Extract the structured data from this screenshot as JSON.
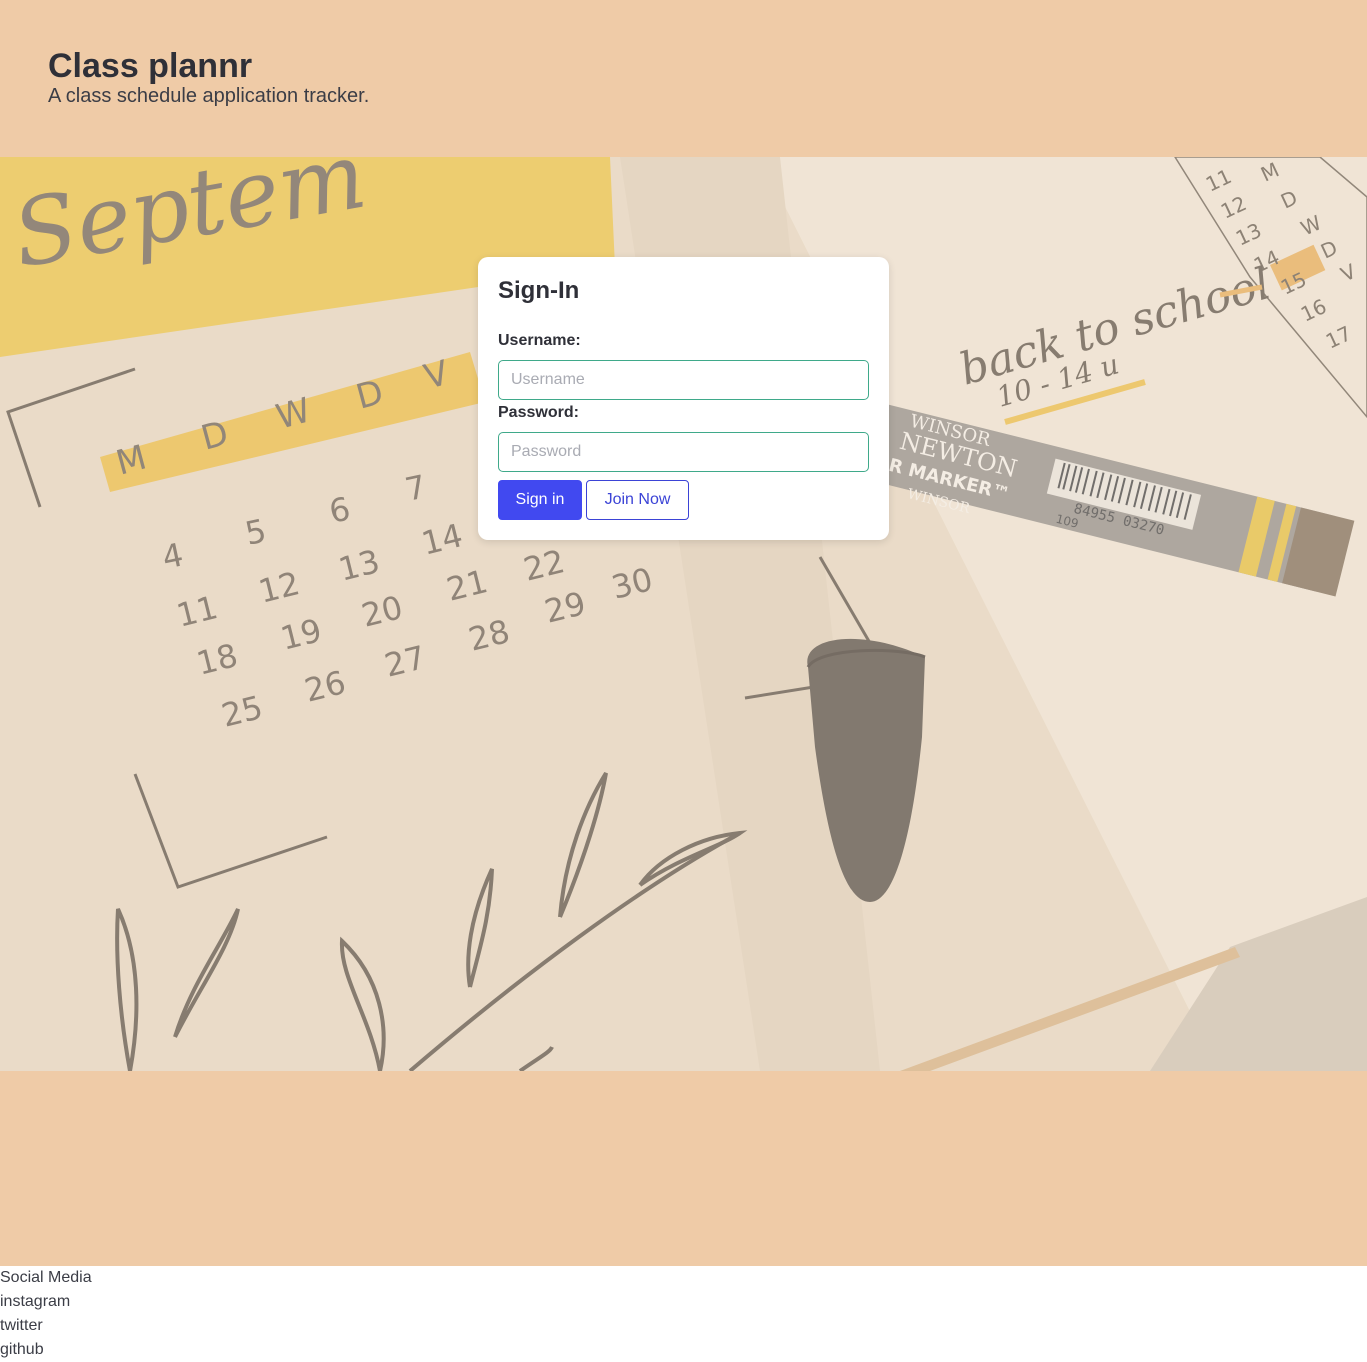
{
  "header": {
    "title": "Class plannr",
    "subtitle": "A class schedule application tracker."
  },
  "signin": {
    "title": "Sign-In",
    "username_label": "Username:",
    "username_placeholder": "Username",
    "username_value": "",
    "password_label": "Password:",
    "password_placeholder": "Password",
    "password_value": "",
    "signin_button": "Sign in",
    "join_button": "Join Now"
  },
  "hero": {
    "month_text": "Septem",
    "weekday_letters": [
      "M",
      "D",
      "W",
      "D",
      "V"
    ],
    "note_line1": "back to school",
    "note_line2": "10 - 14 u",
    "marker_brand1": "WINSOR",
    "marker_brand2": "NEWTON",
    "marker_type": "R MARKER™",
    "marker_brand3": "WINSOR",
    "barcode_number": "84955 03270",
    "marker_code": "109",
    "calendar_numbers": [
      "4",
      "5",
      "6",
      "7",
      "11",
      "12",
      "13",
      "14",
      "18",
      "19",
      "20",
      "21",
      "22",
      "25",
      "26",
      "27",
      "28",
      "29",
      "30"
    ],
    "side_numbers": [
      "11",
      "12",
      "13",
      "14",
      "15",
      "16",
      "17"
    ],
    "side_letters": [
      "M",
      "D",
      "W",
      "D",
      "V"
    ]
  },
  "footer": {
    "heading": "Social Media",
    "links": [
      "instagram",
      "twitter",
      "github"
    ]
  },
  "colors": {
    "band": "#efcba7",
    "primary": "#4149f0",
    "input_border": "#3fa98a"
  }
}
